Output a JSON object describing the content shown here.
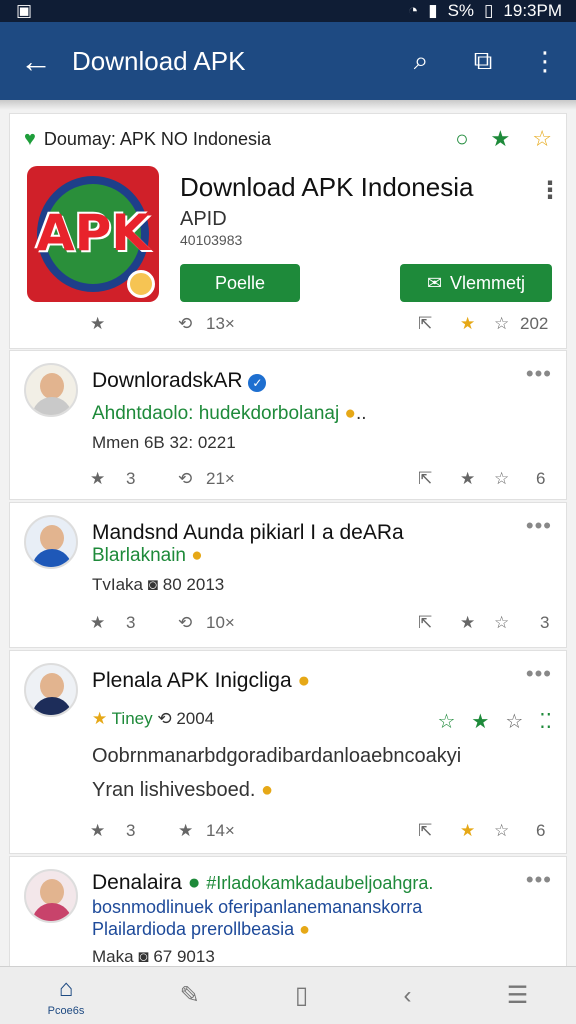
{
  "status": {
    "time": "19:3PM",
    "battery": "S%",
    "wifi_icon": "wifi-icon",
    "signal_icon": "signal-icon",
    "battery_icon": "battery-icon",
    "left_icon": "notification-icon"
  },
  "appbar": {
    "title": "Download APK",
    "back_icon": "arrow-back-icon",
    "search_icon": "search-icon",
    "share_icon": "share-icon",
    "more_icon": "more-vert-icon"
  },
  "app_card": {
    "header": "Doumay: APK NO Indonesia",
    "heart_icon": "heart-icon",
    "title": "Download APK Indonesia",
    "sub": "APID",
    "sub2": "40103983",
    "logo_text": "APK",
    "btn_left": "Poelle",
    "btn_right": "Vlemmetj",
    "btn_right_icon": "mail-icon",
    "stats": {
      "left_count": "13×",
      "right_count": "202"
    }
  },
  "posts": [
    {
      "name": "DownloradskAR",
      "verified": true,
      "line1": "Ahdntdaolo: hudekdorbolanaj",
      "line2": "Mmen 6B 32: 0221",
      "stats": {
        "a": "3",
        "b": "21×",
        "c": "6"
      },
      "avatar_color": "#f2efe6"
    },
    {
      "name": "Mandsnd Aunda pikiarl I a deARa",
      "line1": "Blarlaknain",
      "line2": "TvIaka",
      "line2b": "80 2013",
      "stats": {
        "a": "3",
        "b": "10×",
        "c": "3"
      },
      "avatar_color": "#1e58b8"
    },
    {
      "name": "Plenala APK Inigcliga",
      "line1": "Tiney",
      "line1b": "2004",
      "body1": "Oobrnmanarbdgoradibardanloaebncoakyi",
      "body2": "Yran lishivesboed.",
      "stats": {
        "a": "3",
        "b": "14×",
        "c": "6"
      },
      "avatar_color": "#1d2d5a"
    },
    {
      "name": "Denalaira",
      "tag": "#Irladokamkadaubeljoahgra.",
      "line1": "bosnmodlinuek oferipanlanemananskorra",
      "line2": "Plailardioda prerollbeasia",
      "line3": "Maka",
      "line3b": "67 9013",
      "avatar_color": "#c8436b"
    }
  ],
  "bottom_nav": {
    "home_label": "Pcoe6s",
    "home_icon": "home-icon",
    "chat_icon": "chat-icon",
    "doc_icon": "document-icon",
    "back_icon": "back-chevron-icon",
    "settings_icon": "settings-icon"
  }
}
